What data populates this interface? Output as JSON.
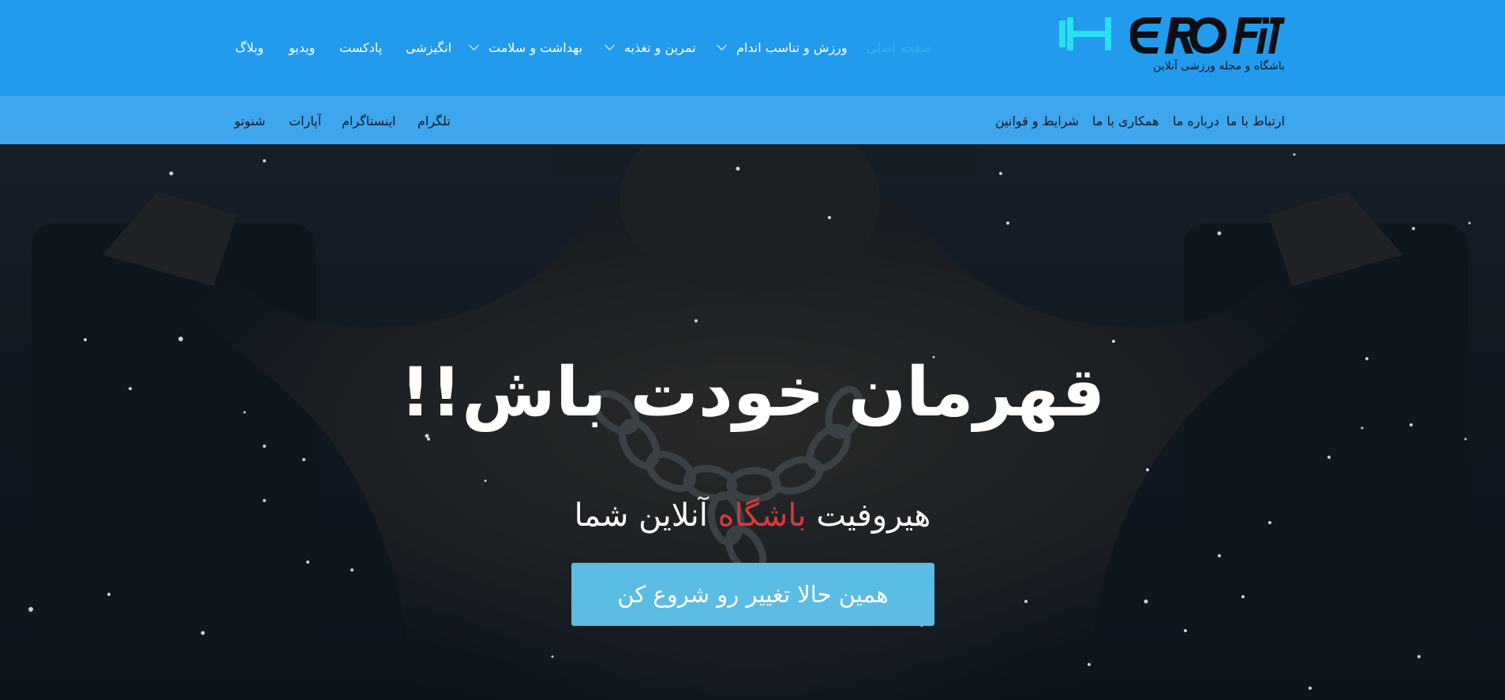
{
  "logo": {
    "brand": "HEROFIT",
    "tagline": "باشگاه و مجله ورزشی آنلاین"
  },
  "main_nav": [
    {
      "label": "صفحه اصلی",
      "active": true
    },
    {
      "label": "ورزش و تناسب اندام",
      "dropdown": true
    },
    {
      "label": "تمرین و تغذیه",
      "dropdown": true
    },
    {
      "label": "بهداشت و سلامت",
      "dropdown": true
    },
    {
      "label": "انگیزشی"
    },
    {
      "label": "پادکست"
    },
    {
      "label": "ویدیو"
    },
    {
      "label": "وبلاگ"
    }
  ],
  "sub_nav": {
    "pages": [
      "ارتباط با ما",
      "درباره ما",
      "همکاری با ما",
      "شرایط و قوانین"
    ],
    "social": [
      "تلگرام",
      "اینستاگرام",
      "آپارات",
      "شنوتو"
    ]
  },
  "hero": {
    "title": "قهرمان خودت باش!!",
    "subtitle_part1": "هیروفیت",
    "subtitle_accent": "باشگاه",
    "subtitle_part2": "آنلاین شما",
    "cta": "همین حالا تغییر رو شروع کن"
  },
  "colors": {
    "header": "#229bec",
    "subbar": "#3ea6ec",
    "accent": "#d9383a",
    "cta": "#5bbde3"
  }
}
